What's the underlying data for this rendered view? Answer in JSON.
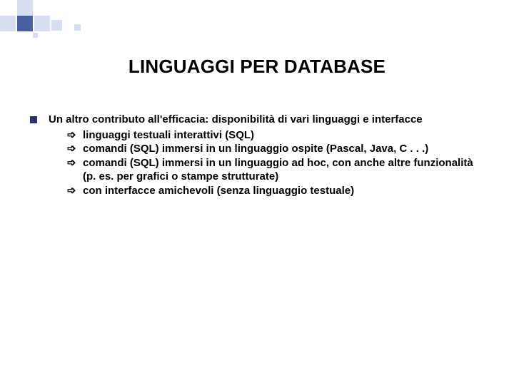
{
  "title": "LINGUAGGI PER DATABASE",
  "bullet": {
    "intro": "Un altro contributo all'efficacia: disponibilità di vari linguaggi e interfacce",
    "items": [
      "linguaggi testuali interattivi (SQL)",
      "comandi (SQL) immersi in un linguaggio ospite (Pascal, Java, C . . .)",
      "comandi (SQL) immersi in un linguaggio ad hoc, con anche altre funzionalità (p. es. per grafici o stampe strutturate)",
      "con interfacce amichevoli (senza linguaggio testuale)"
    ]
  },
  "arrow_glyph": "➩"
}
